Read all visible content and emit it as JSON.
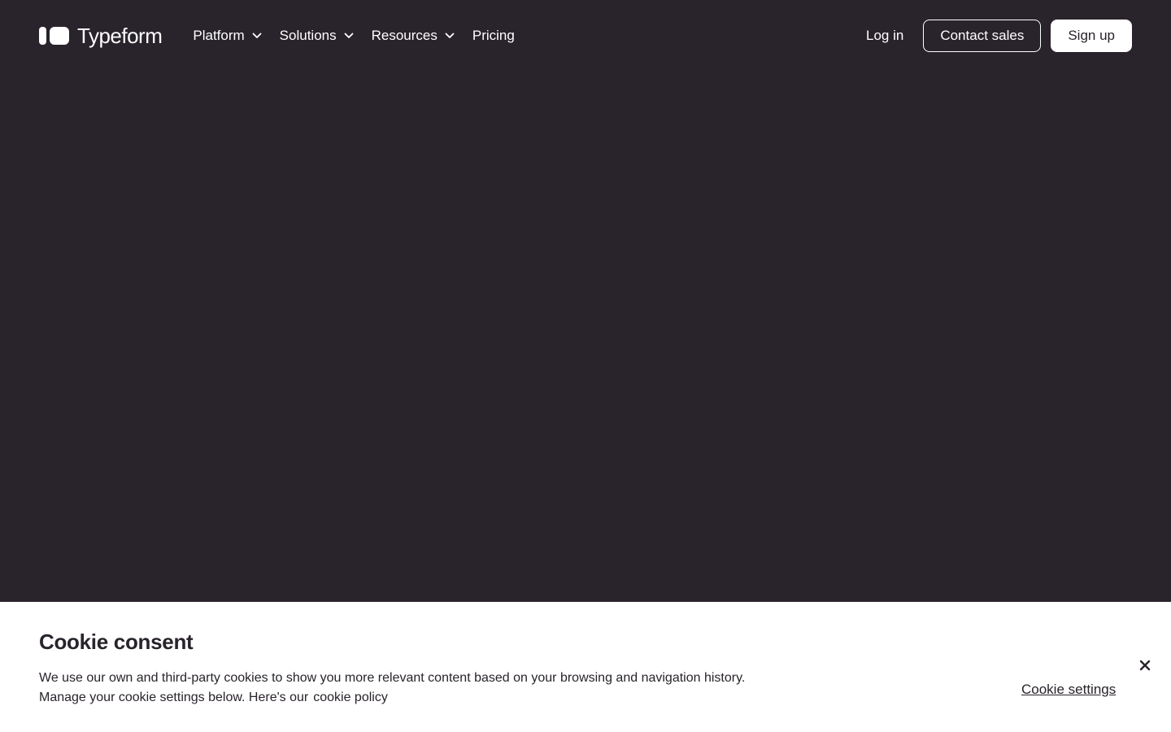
{
  "brand": {
    "name": "Typeform",
    "logo_icon": "typeform-logo-icon"
  },
  "nav": {
    "items": [
      {
        "label": "Platform",
        "has_dropdown": true
      },
      {
        "label": "Solutions",
        "has_dropdown": true
      },
      {
        "label": "Resources",
        "has_dropdown": true
      },
      {
        "label": "Pricing",
        "has_dropdown": false
      }
    ],
    "login_label": "Log in",
    "contact_label": "Contact sales",
    "signup_label": "Sign up"
  },
  "cookie_banner": {
    "title": "Cookie consent",
    "text_line1": "We use our own and third-party cookies to show you more relevant content based on your browsing and navigation history.",
    "text_line2": "Manage your cookie settings below. Here's our",
    "policy_link": "cookie policy",
    "settings_label": "Cookie settings",
    "close_icon": "close-icon"
  },
  "colors": {
    "background": "#29232b",
    "banner": "#ffffff",
    "text_dark": "#29232b"
  }
}
